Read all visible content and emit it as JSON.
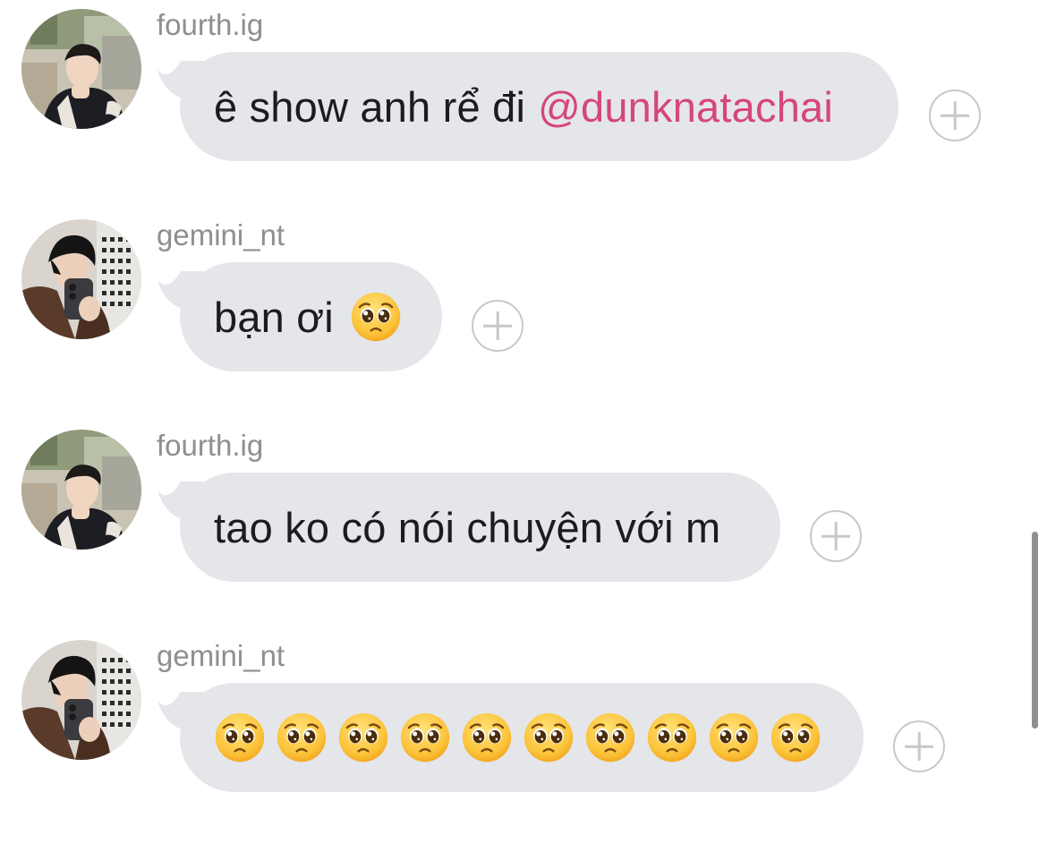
{
  "messages": [
    {
      "username": "fourth.ig",
      "text": "ê show anh rể đi",
      "mention": "@dunknatachai",
      "emoji": ""
    },
    {
      "username": "gemini_nt",
      "text": "bạn ơi",
      "emoji": "pleading-face"
    },
    {
      "username": "fourth.ig",
      "text": "tao ko có nói chuyện với m"
    },
    {
      "username": "gemini_nt",
      "emoji": "pleading-face",
      "emoji_count": 10
    }
  ],
  "colors": {
    "bubble": "#e4e6ea",
    "mention": "#d6457c",
    "username": "#8e8e93",
    "text": "#1c1c1e",
    "react_button": "#c7c7cc"
  },
  "icons": {
    "react": "add-reaction-icon",
    "emoji": "pleading-face-icon"
  }
}
